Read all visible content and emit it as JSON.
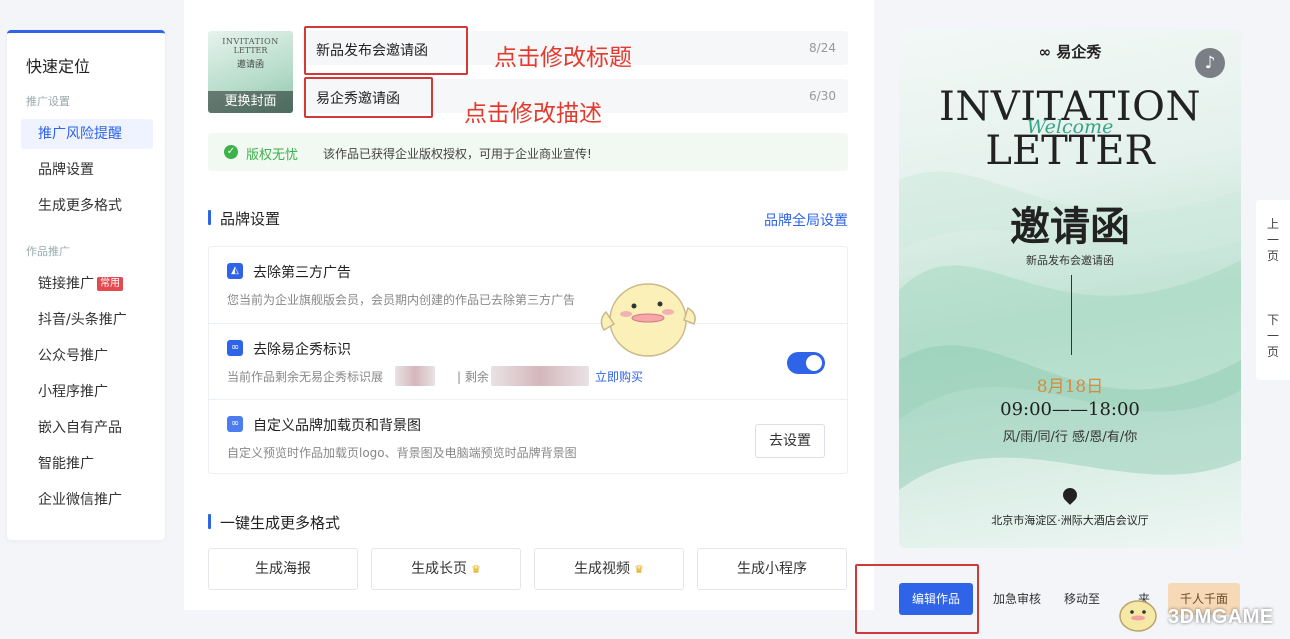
{
  "sidebar": {
    "title": "快速定位",
    "group1": "推广设置",
    "group1_items": [
      "推广风险提醒",
      "品牌设置",
      "生成更多格式"
    ],
    "group2": "作品推广",
    "group2_items": [
      "链接推广",
      "抖音/头条推广",
      "公众号推广",
      "小程序推广",
      "嵌入自有产品",
      "智能推广",
      "企业微信推广"
    ],
    "badge": "常用"
  },
  "cover": {
    "line1": "INVITATION",
    "line2": "LETTER",
    "line3": "邀请函",
    "change_label": "更换封面"
  },
  "title_field": {
    "value": "新品发布会邀请函",
    "count": "8/24"
  },
  "desc_field": {
    "value": "易企秀邀请函",
    "count": "6/30"
  },
  "annotations": {
    "title_hint": "点击修改标题",
    "desc_hint": "点击修改描述"
  },
  "copyright": {
    "check_icon": "check-circle-icon",
    "label": "版权无忧",
    "desc": "该作品已获得企业版权授权，可用于企业商业宣传!"
  },
  "brand": {
    "title": "品牌设置",
    "global_link": "品牌全局设置",
    "rows": [
      {
        "title": "去除第三方广告",
        "desc": "您当前为企业旗舰版会员，会员期内创建的作品已去除第三方广告"
      },
      {
        "title": "去除易企秀标识",
        "desc_prefix": "当前作品剩余无易企秀标识展",
        "desc_mid": "| 剩余",
        "buy_link": "立即购买",
        "toggle_on": true
      },
      {
        "title": "自定义品牌加载页和背景图",
        "desc": "自定义预览时作品加载页logo、背景图及电脑端预览时品牌背景图",
        "button": "去设置"
      }
    ]
  },
  "formats": {
    "title": "一键生成更多格式",
    "buttons": [
      "生成海报",
      "生成长页",
      "生成视频",
      "生成小程序"
    ]
  },
  "preview": {
    "logo": "易企秀",
    "line1": "INVITATION",
    "welcome": "Welcome",
    "line2": "LETTER",
    "title_cn": "邀请函",
    "subtitle": "新品发布会邀请函",
    "date": "8月18日",
    "time": "09:00——18:00",
    "motto": "风/雨/同/行  感/恩/有/你",
    "address": "北京市海淀区·洲际大酒店会议厅",
    "music_icon": "music-note-icon"
  },
  "pager": {
    "prev": "上一页",
    "next": "下一页"
  },
  "actions": {
    "edit": "编辑作品",
    "urgent": "加急审核",
    "mobile": "移动至",
    "mobile_tail": "夹",
    "gold": "千人千面"
  },
  "watermark": "3DMGAME",
  "colors": {
    "accent": "#2f64e8",
    "annotation": "#e23b2e",
    "success": "#3cb24a"
  }
}
